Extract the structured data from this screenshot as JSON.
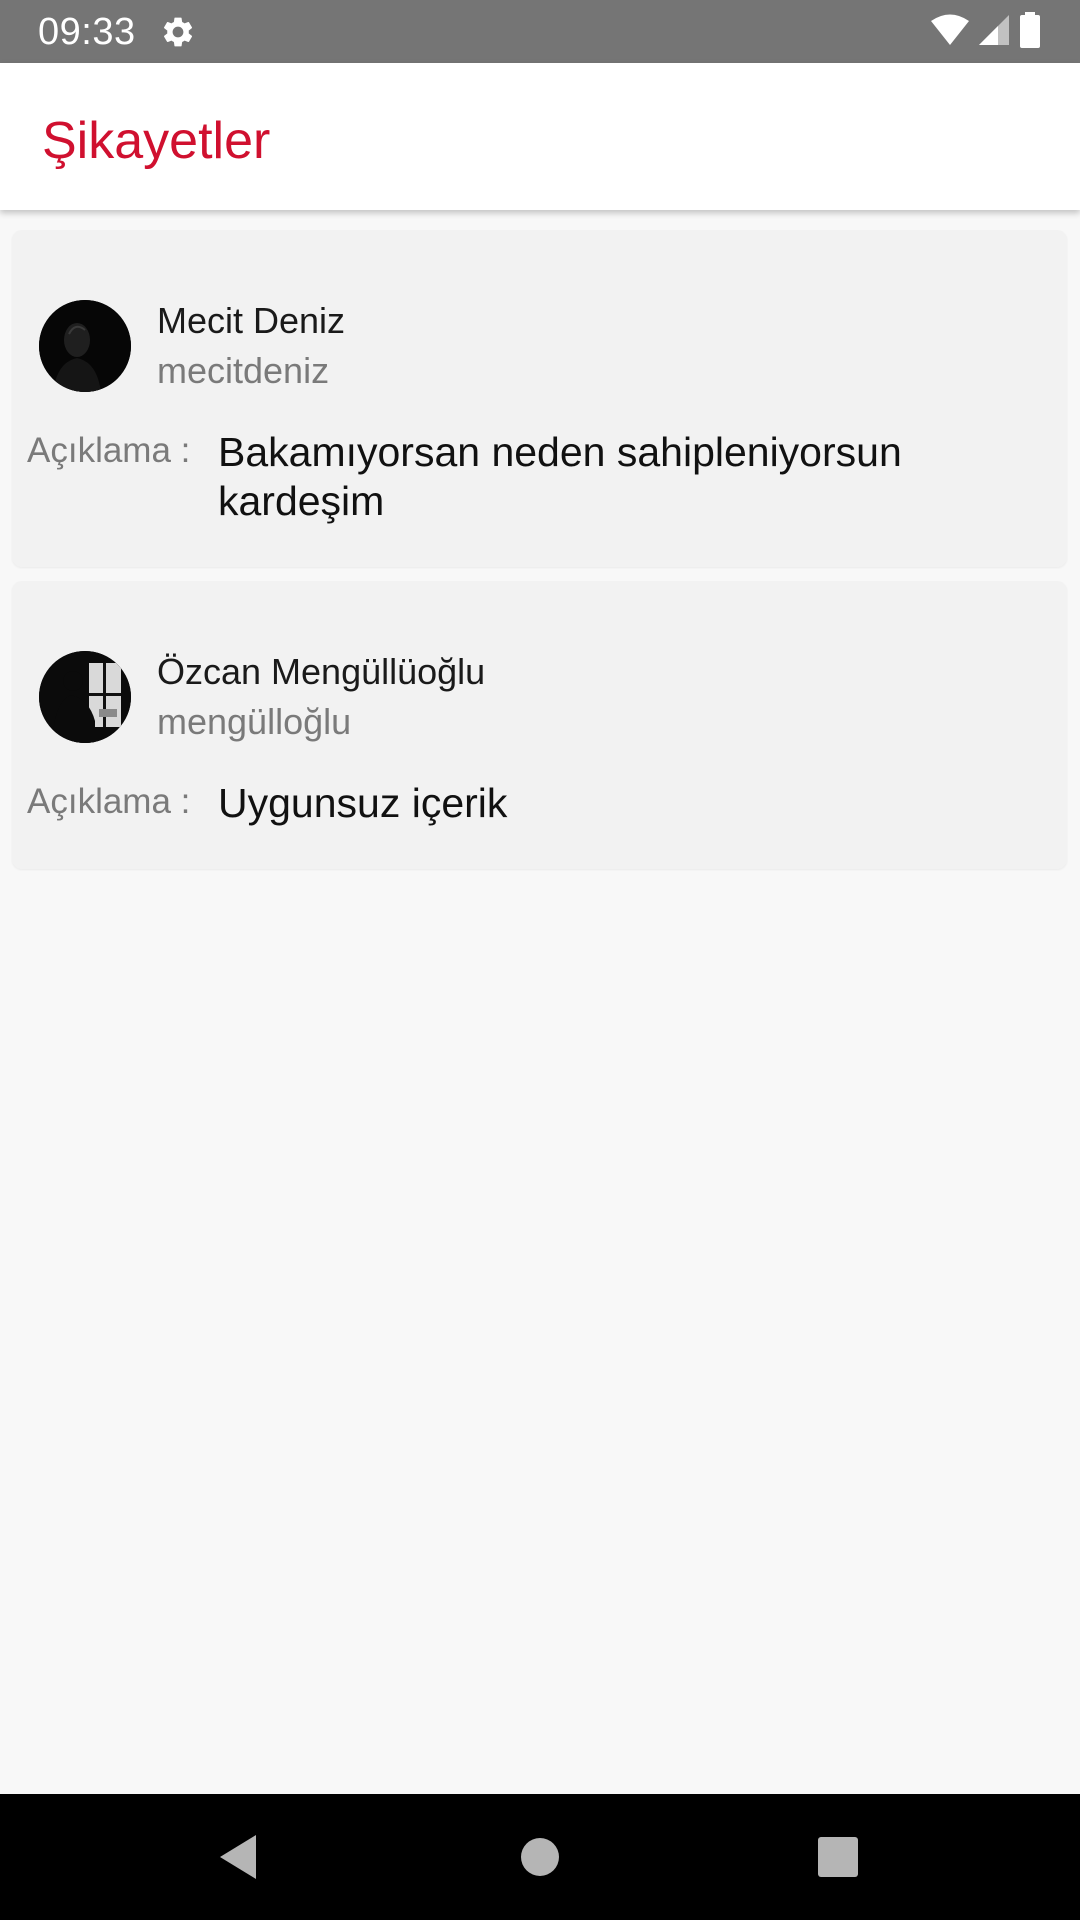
{
  "status_bar": {
    "time": "09:33",
    "icons": [
      "gear-icon",
      "wifi-icon",
      "signal-icon",
      "battery-icon"
    ]
  },
  "app_bar": {
    "title": "Şikayetler",
    "title_color": "#d0102f"
  },
  "complaints": [
    {
      "name": "Mecit Deniz",
      "username": "mecitdeniz",
      "description_label": "Açıklama :",
      "description": "Bakamıyorsan neden sahipleniyorsun kardeşim"
    },
    {
      "name": "Özcan Mengüllüoğlu",
      "username": "mengülloğlu",
      "description_label": "Açıklama :",
      "description": "Uygunsuz içerik"
    }
  ],
  "nav_bar": {
    "icons": [
      "back-icon",
      "home-icon",
      "recents-icon"
    ]
  }
}
